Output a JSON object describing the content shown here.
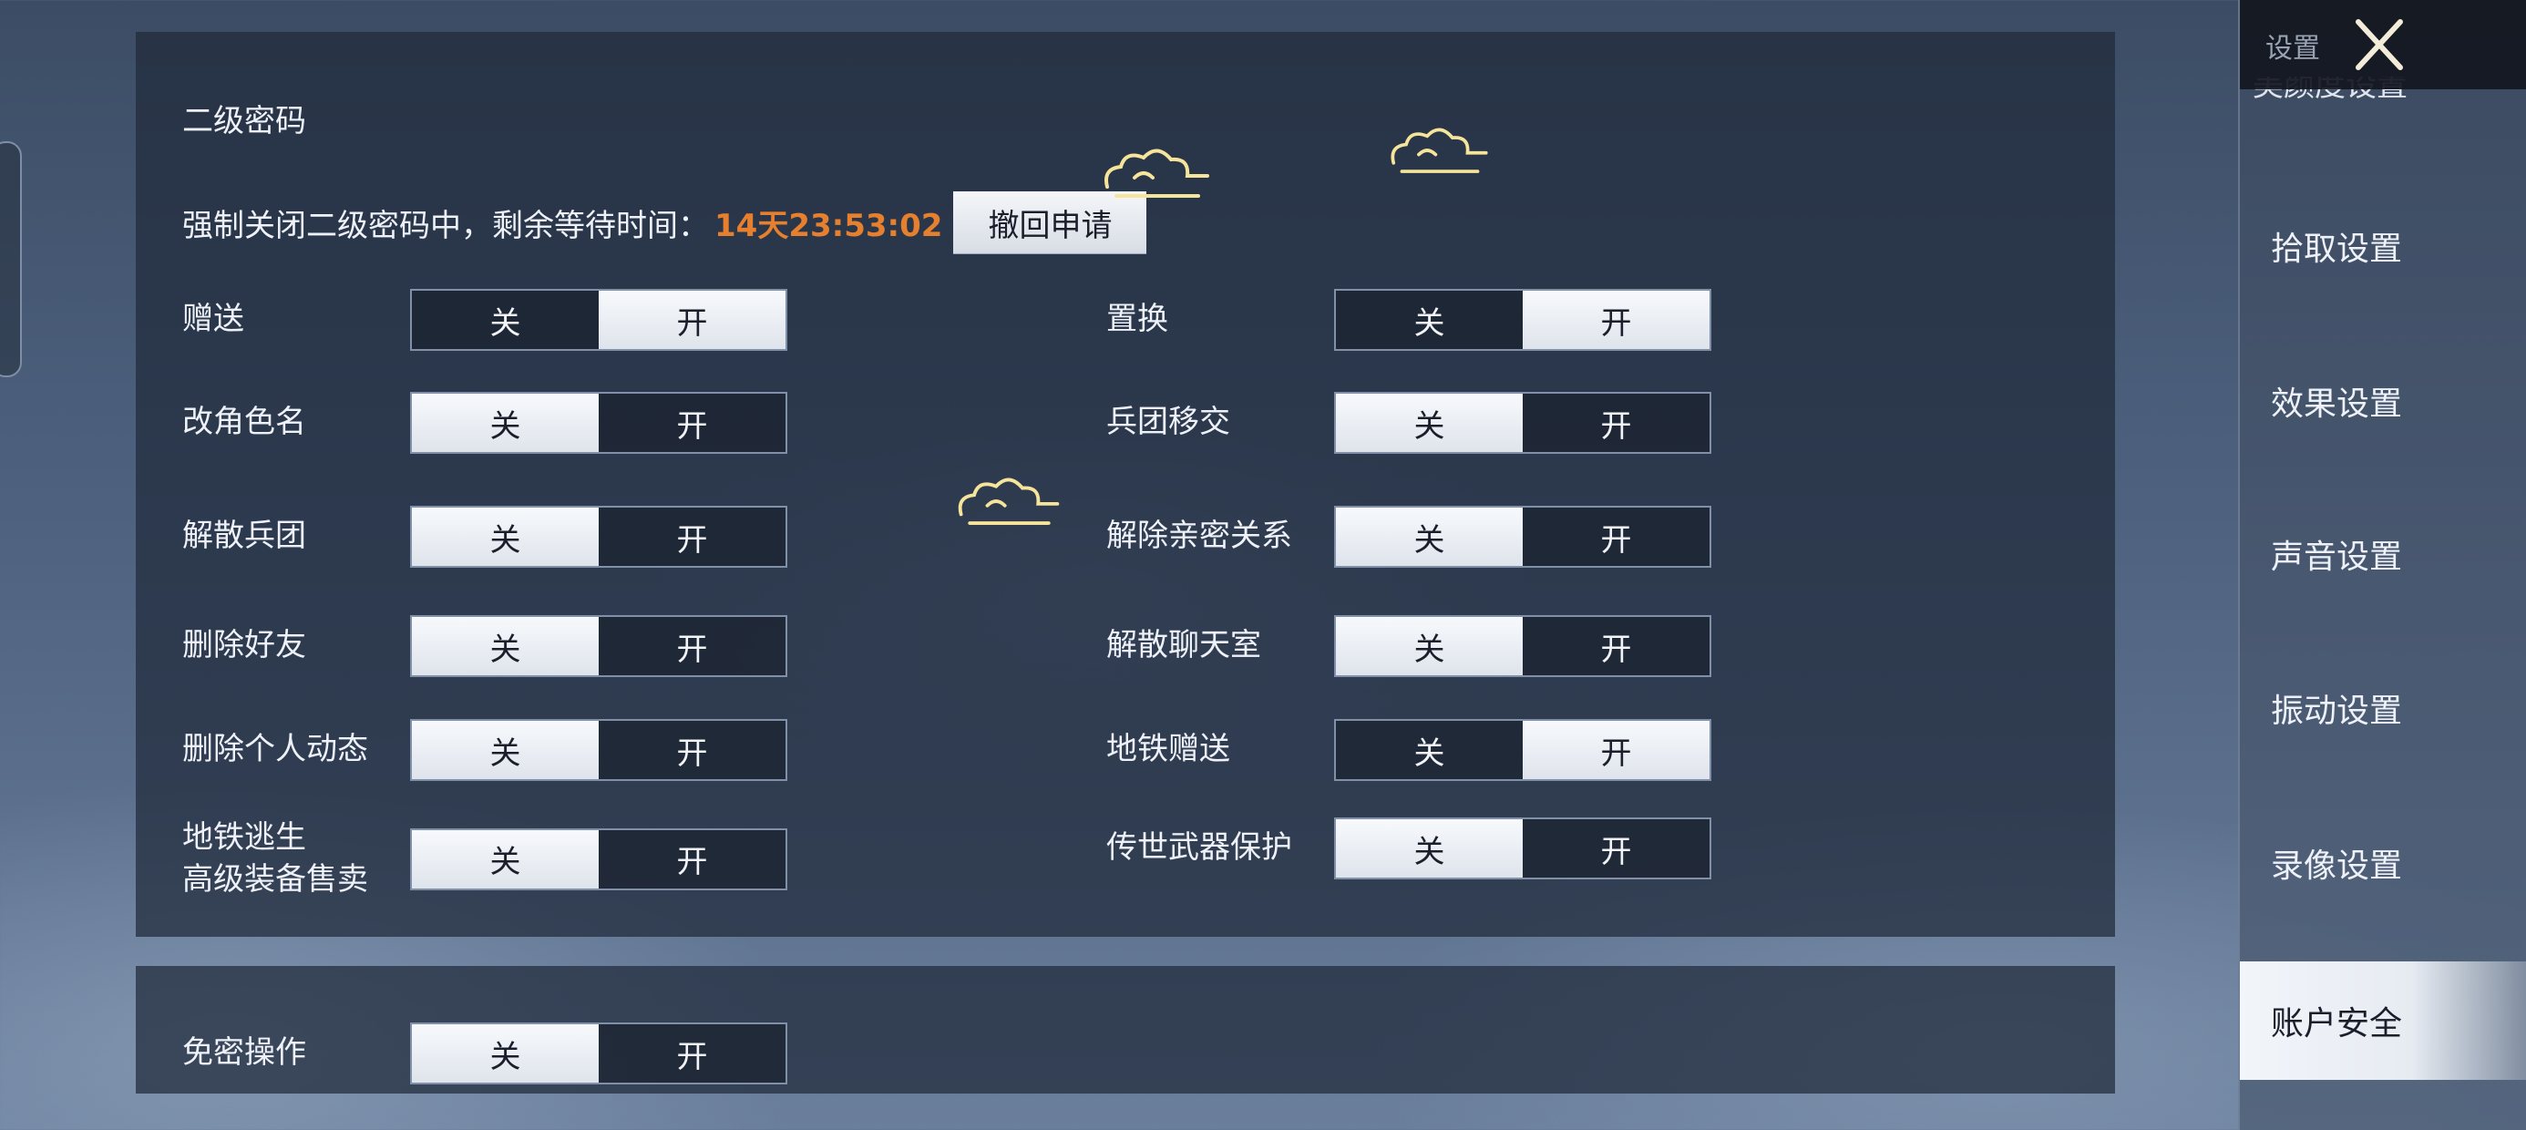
{
  "window": {
    "title": "设置"
  },
  "sidebar": {
    "partial_item": "美颜度设置",
    "items": [
      {
        "label": "拾取设置"
      },
      {
        "label": "效果设置"
      },
      {
        "label": "声音设置"
      },
      {
        "label": "振动设置"
      },
      {
        "label": "录像设置"
      },
      {
        "label": "账户安全",
        "active": true
      }
    ]
  },
  "section": {
    "title": "二级密码",
    "notice": "强制关闭二级密码中，剩余等待时间：",
    "countdown": "14天23:53:02",
    "revoke_button": "撤回申请"
  },
  "toggle_labels": {
    "off": "关",
    "on": "开"
  },
  "settings_left": [
    {
      "label": "赠送",
      "value": "开"
    },
    {
      "label": "改角色名",
      "value": "关"
    },
    {
      "label": "解散兵团",
      "value": "关"
    },
    {
      "label": "删除好友",
      "value": "关"
    },
    {
      "label": "删除个人动态",
      "value": "关"
    },
    {
      "label": "地铁逃生\n高级装备售卖",
      "value": "关"
    }
  ],
  "settings_right": [
    {
      "label": "置换",
      "value": "开"
    },
    {
      "label": "兵团移交",
      "value": "关"
    },
    {
      "label": "解除亲密关系",
      "value": "关"
    },
    {
      "label": "解散聊天室",
      "value": "关"
    },
    {
      "label": "地铁赠送",
      "value": "开"
    },
    {
      "label": "传世武器保护",
      "value": "关"
    }
  ],
  "section2": {
    "label": "免密操作",
    "value": "关"
  },
  "colors": {
    "countdown": "#e6802e",
    "panel": "#202a3a",
    "active_tab": "#f2f5fa"
  },
  "icons": [
    "close-icon",
    "cloud-icon"
  ]
}
